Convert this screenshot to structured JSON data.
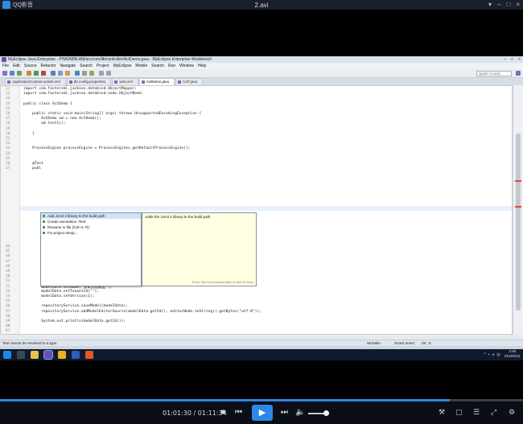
{
  "player": {
    "app_name": "QQ影音",
    "filename": "2.avi",
    "time_current": "01:01:30",
    "time_total": "01:11:34",
    "time_separator": "/",
    "progress_fraction": 0.86,
    "volume_fraction": 0.85
  },
  "ide": {
    "window_title": "MyEclipse Java Enterprise - PHADMIN.AM/src/com/lib/controller/ActDemo.java - MyEclipse Enterprise Workbench",
    "menu": [
      "File",
      "Edit",
      "Source",
      "Refactor",
      "Navigate",
      "Search",
      "Project",
      "MyEclipse",
      "Mobile",
      "Search",
      "Run",
      "Window",
      "Help"
    ],
    "quick_access_placeholder": "Quick Access",
    "tabs": [
      {
        "label": "ApplicationContext-activiti.xml"
      },
      {
        "label": "db.config.properties"
      },
      {
        "label": "web.xml"
      },
      {
        "label": "ActDemo.java",
        "active": true
      },
      {
        "label": "ActT.java"
      }
    ],
    "code_lines": [
      {
        "num": "11",
        "text": "import com.fasterxml.jackson.databind.ObjectMapper;"
      },
      {
        "num": "12",
        "text": "import com.fasterxml.jackson.databind.node.ObjectNode;"
      },
      {
        "num": "13",
        "text": ""
      },
      {
        "num": "14",
        "text": "public class ActDemo {"
      },
      {
        "num": "15",
        "text": ""
      },
      {
        "num": "16",
        "text": "    public static void main(String[] args) throws UnsupportedEncodingException {"
      },
      {
        "num": "17",
        "text": "        ActDemo ad = new ActDemo();"
      },
      {
        "num": "18",
        "text": "        ad.test1();"
      },
      {
        "num": "19",
        "text": ""
      },
      {
        "num": "20",
        "text": "    }"
      },
      {
        "num": "21",
        "text": ""
      },
      {
        "num": "22",
        "text": ""
      },
      {
        "num": "23",
        "text": "    ProcessEngine processEngine = ProcessEngines.getDefaultProcessEngine();"
      },
      {
        "num": "24",
        "text": ""
      },
      {
        "num": "25",
        "text": ""
      },
      {
        "num": "26",
        "text": "    @Test"
      },
      {
        "num": "27",
        "text": "    publ"
      }
    ],
    "code_lines_lower": [
      {
        "num": "44",
        "text": "        modelObjectNode.put(\"description\", \"admin\");"
      },
      {
        "num": "45",
        "text": ""
      },
      {
        "num": "46",
        "text": ""
      },
      {
        "num": "47",
        "text": "        Model modelData = repositoryService.newModel();"
      },
      {
        "num": "48",
        "text": "        modelData.setCategory(null);"
      },
      {
        "num": "49",
        "text": "        modelData.setDeploymentId(null);"
      },
      {
        "num": "50",
        "text": "        modelData.setKey(null);"
      },
      {
        "num": "51",
        "text": "        modelData.setMetaInfo(modelObjectNode.toString());"
      },
      {
        "num": "52",
        "text": "        modelData.setName(\"测试流程模型\");"
      },
      {
        "num": "53",
        "text": "        modelData.setTenantId(\"\");"
      },
      {
        "num": "54",
        "text": "        modelData.setVersion(1);"
      },
      {
        "num": "55",
        "text": ""
      },
      {
        "num": "56",
        "text": "        repositoryService.saveModel(modelData);"
      },
      {
        "num": "57",
        "text": "        repositoryService.addModelEditorSource(modelData.getId(), editorNode.toString().getBytes(\"utf-8\"));"
      },
      {
        "num": "58",
        "text": ""
      },
      {
        "num": "59",
        "text": "        System.out.println(modelData.getId());"
      },
      {
        "num": "60",
        "text": ""
      },
      {
        "num": "61",
        "text": ""
      },
      {
        "num": "62",
        "text": ""
      },
      {
        "num": "63",
        "text": ""
      },
      {
        "num": "64",
        "text": "    }"
      },
      {
        "num": "65",
        "text": ""
      },
      {
        "num": "66",
        "text": "}"
      }
    ],
    "quickfix": {
      "items": [
        {
          "label": "Add JUnit 4 library to the build path",
          "selected": true
        },
        {
          "label": "Create annotation 'Test'"
        },
        {
          "label": "Rename in file (Ctrl+2, R)"
        },
        {
          "label": "Fix project setup..."
        }
      ],
      "doc_text": "Adds the JUnit 4 library to the build path",
      "doc_footer": "Press 'Tab' from proposal table or click for focus"
    },
    "status": {
      "message": "Test cannot be resolved to a type",
      "mode": "Writable",
      "insert": "Smart Insert",
      "position": "25 : 8"
    }
  },
  "taskbar": {
    "time": "2:55",
    "date": "2016/8/11"
  }
}
